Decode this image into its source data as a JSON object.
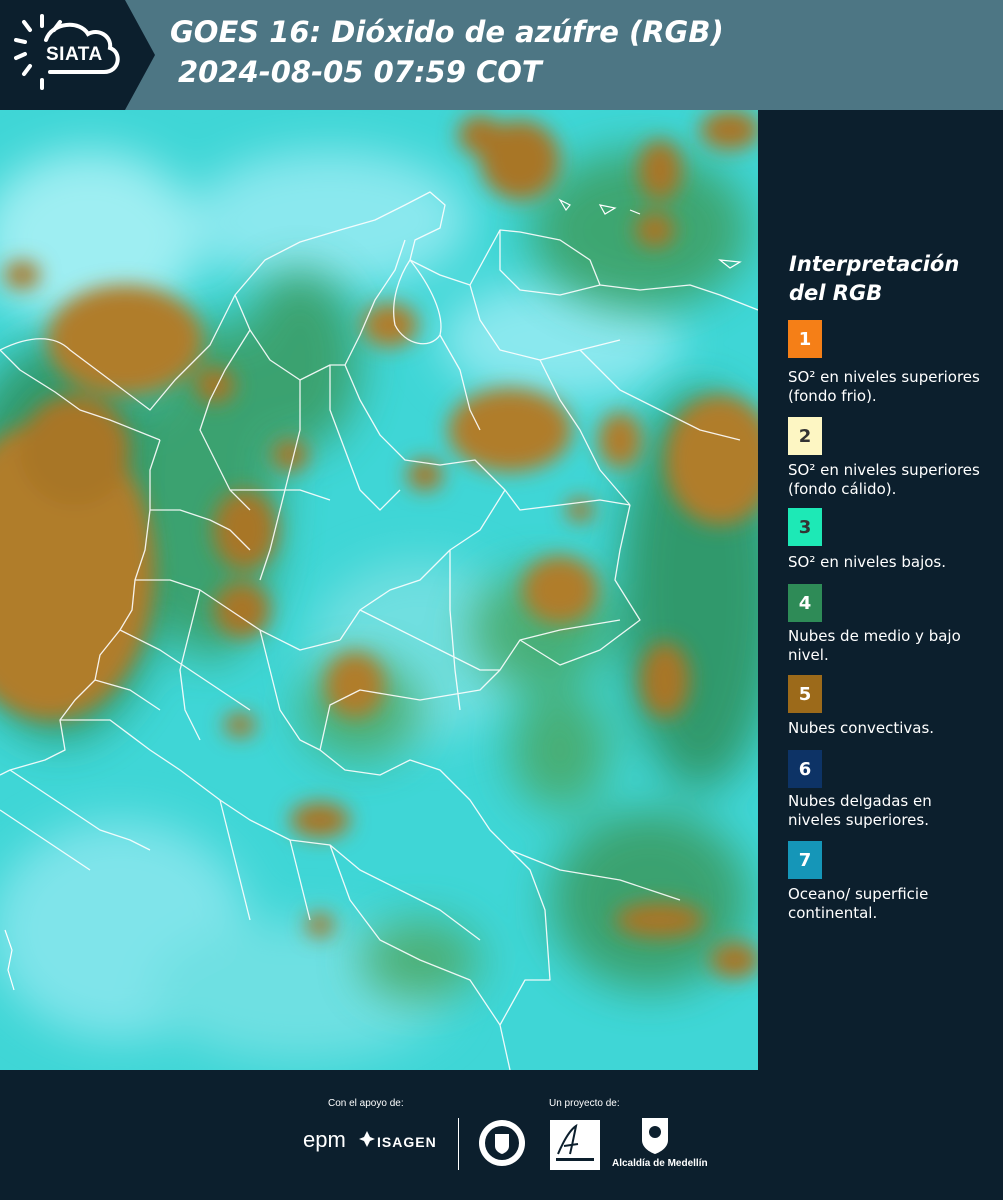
{
  "header": {
    "logo_text": "SIATA",
    "title_line1": "GOES 16: Dióxido de azúfre (RGB)",
    "title_line2": "2024-08-05 07:59 COT"
  },
  "legend": {
    "title": "Interpretación del RGB",
    "items": [
      {
        "number": "1",
        "color": "#f57f17",
        "text": "SO² en niveles superiores (fondo frio)."
      },
      {
        "number": "2",
        "color": "#fdf6c3",
        "text": "SO² en niveles superiores (fondo cálido)."
      },
      {
        "number": "3",
        "color": "#1de9b6",
        "text": "SO² en niveles bajos."
      },
      {
        "number": "4",
        "color": "#2e8b57",
        "text": "Nubes de medio y bajo nivel."
      },
      {
        "number": "5",
        "color": "#9c6a1a",
        "text": "Nubes convectivas."
      },
      {
        "number": "6",
        "color": "#0d3366",
        "text": "Nubes delgadas en niveles superiores."
      },
      {
        "number": "7",
        "color": "#1596b8",
        "text": "Oceano/ superficie continental."
      }
    ]
  },
  "footer": {
    "support_label": "Con el apoyo de:",
    "project_label": "Un proyecto de:",
    "epm": "epm",
    "isagen": "ISAGEN",
    "alcaldia": "Alcaldía de Medellín"
  },
  "colors": {
    "background": "#0c1f2d",
    "header": "#4d7684",
    "map_base": "#3fd6d6",
    "cloud": "#b07d2a",
    "green": "#2f8f5a"
  }
}
